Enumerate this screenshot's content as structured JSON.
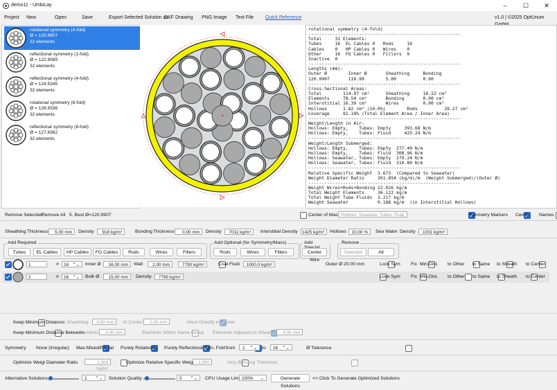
{
  "window": {
    "title": "demo11 - UmbiLay",
    "version": "v1.0 | ©2025 OptUnum GmbH"
  },
  "menu": {
    "project": "Project",
    "new": "New",
    "open": "Open",
    "save": "Save",
    "export_label": "Export Selected Solution as",
    "dxf": "DXF Drawing",
    "png": "PNG Image",
    "text": "Text File",
    "quick_ref": "Quick Reference"
  },
  "solutions": [
    {
      "name": "rotational symmetry (4-fold)",
      "diam": "Ø = 120.9907",
      "count": "32 elements"
    },
    {
      "name": "reflectional symmetry (1-fold)",
      "diam": "Ø = 122.9089",
      "count": "32 elements"
    },
    {
      "name": "reflectional symmetry (4-fold)",
      "diam": "Ø = 124.5345",
      "count": "32 elements"
    },
    {
      "name": "rotational symmetry (8-fold)",
      "diam": "Ø = 126.9336",
      "count": "32 elements"
    },
    {
      "name": "reflectional symmetry (8-fold)",
      "diam": "Ø = 127.8362",
      "count": "32 elements"
    }
  ],
  "report": {
    "lines": [
      "rotational symmetry (4-fold)",
      "---------------------------------------------------------",
      "Total     32 Elements:",
      "Tubes     16  EL Cables 0   Rods     16",
      "Cables    0   HP Cables 0   Wires    0",
      "Other     16  FO Cables 0   Fillers  0",
      "Inactive  0",
      "---------------------------------------------------------",
      "Lengths (mm):",
      "Outer Ø        Inner Ø       Sheathing     Bonding",
      "120.9907       110.99        5.00          0.00",
      "---------------------------------------------------------",
      "Cross-Sectional Areas:",
      "Total        114.97 cm²      Sheathing     18.22 cm²",
      "Elements     78.54 cm²       Bonding       0.00 cm²",
      "Interstitial 16.39 cm²       Wires         0.00 cm²",
      "Hollows      1.82 cm² (10.0%)        Rods          28.27 cm²",
      "Coverage     81.18% (Total Element Area / Inner Area)",
      "---------------------------------------------------------",
      "Weight/Length in Air:",
      "Hollows: Empty,    Tubes: Empty     393.68 N/m",
      "Hollows: Empty,    Tubes: Fluid     425.24 N/m",
      "---------------------------------------------------------",
      "Weight/Length Submerged:",
      "Hollows: Empty,    Tubes: Empty  277.40 N/m",
      "Hollows: Empty,    Tubes: Fluid  308.96 N/m",
      "Hollows: Seawater, Tubes: Empty  279.24 N/m",
      "Hollows: Seawater, Tubes: Fluid  310.80 N/m",
      "---------------------------------------------------------",
      "Relative Specific Weight  3.673  (Compared to Seawater)",
      "Weight Diameter Ratio     261.854 (kg/m)/m  (Weight Submerged)/(Outer Ø)",
      "---------------------------------------------------------",
      "Weight Wires+Rods+Bonding 22.026 kg/m",
      "Total Weight Elements     36.122 kg/m",
      "Total Weight Tube Fluids  3.217 kg/m",
      "Weight Seawater           0.188 kg/m  (in Interstitial Hollows)"
    ]
  },
  "under": {
    "remove_sel": "Remove Selected",
    "remove_all": "Remove All",
    "best": "5, Best Ø=120.9907",
    "center_mass": "Center of Mass",
    "hollows_sel": "Hollows: Seawater, Tubes: Fluid",
    "sym_markers": "Symmetry Markers",
    "center": "Center",
    "names": "Names"
  },
  "params": {
    "sheathing": "Sheathing",
    "thickness": "Thickness",
    "sh_thick": "5,00 mm",
    "density": "Density",
    "sh_dens": "918 kg/m³",
    "bonding": "Bonding",
    "bd_thick": "0,00 mm",
    "bd_dens": "7011 kg/m³",
    "interstitial": "Interstitial",
    "density2": "Density",
    "in_dens": "1425 kg/m³",
    "hollows": "Hollows",
    "hol_val": "10,00 %",
    "sea": "Sea Water",
    "density3": "Density",
    "sea_dens": "1031 kg/m³"
  },
  "add_required": {
    "title": "Add Required",
    "buttons": [
      "Tubes",
      "EL Cables",
      "HP Cables",
      "FO Cables",
      "Rods",
      "Wires",
      "Fillers"
    ]
  },
  "add_optional": {
    "title": "Add Optional (for Symmetry/Mass)",
    "buttons": [
      "Rods",
      "Wires",
      "Fillers"
    ]
  },
  "add_special": {
    "title": "Add Special",
    "buttons": [
      "Center Wire"
    ]
  },
  "remove": {
    "title": "Remove",
    "buttons": [
      "Selected",
      "All"
    ]
  },
  "rows": [
    {
      "qty": "1",
      "hash": "#",
      "sym": "16",
      "dim_label": "Inner Ø",
      "dim": "16,00 mm",
      "wall_label": "Wall",
      "wall": "2,00 mm",
      "dens": "7790 kg/m³",
      "coat": "Coat",
      "fluid_label": "Fluid",
      "fluid": "1000,0 kg/m³",
      "outer": "Outer Ø 20.00 mm",
      "lock": "Lock Sym",
      "fix": "Fix",
      "mindist": "Min.Dist.",
      "other": "to Other",
      "same": "to Same",
      "sheath": "to Sheath",
      "center": "to Center"
    },
    {
      "qty": "2",
      "hash": "#",
      "sym": "16",
      "dim_label": "Bulk Ø",
      "dim": "15,00 mm",
      "dens_label": "Density",
      "dens": "7790 kg/m³",
      "lock": "Lock Sym",
      "fix": "Fix",
      "mindist": "Min.Dist.",
      "other": "to Other",
      "same": "to Same",
      "sheath": "to Sheath",
      "center": "to Center"
    }
  ],
  "opts": {
    "keep_min": "Keep Minimum Distance",
    "to_sheathing": "to Sheathing",
    "ts_val": "3,00 mm",
    "to_center": "to Center",
    "tc_val": "0,00 mm",
    "allow_center": "Allow Directly in Center",
    "keep_between": "Keep Minimum Distance Between",
    "elements": "Elements",
    "el_val": "3,00 mm",
    "within_group": "Elements Within Same Group",
    "adj_sheath": "Elements Adjacent to Sheathing",
    "adj_val": "4,00 mm"
  },
  "symmetry": {
    "label": "Symmetry",
    "none": "None (Irregular)",
    "maxmixed": "Max.Mixed/Partial",
    "rot": "Purely Rotational",
    "refl": "Purely Reflectional",
    "minfold": "Min. Fold",
    "from": "from",
    "from_val": "1",
    "to": "to",
    "to_val": "16",
    "tol": "Ø Tolerance"
  },
  "optimize": {
    "wdr": "Optimize Weigt Diameter Ratio",
    "wdr_val": "1,000 kg/m²",
    "rsw": "Optimize Relative Specific Weight",
    "rsw_val": "1,000",
    "vb": "Very Bonding Thickness"
  },
  "bottom": {
    "alt": "Alternative Solutions",
    "alt_val": "1",
    "quality": "Solution Quality",
    "q_val": "0",
    "cpu": "CPU Usage Limit",
    "cpu_val": "100%",
    "gen": "Generate Solutions",
    "hint": "<< Click To Generate Optimized Solutions"
  },
  "colors": {
    "accent": "#2f7fe6",
    "sheath": "#f2f200",
    "tube_fill": "#ffffff",
    "rod_fill": "#a9a9a9",
    "inner": "#d9dde0"
  }
}
